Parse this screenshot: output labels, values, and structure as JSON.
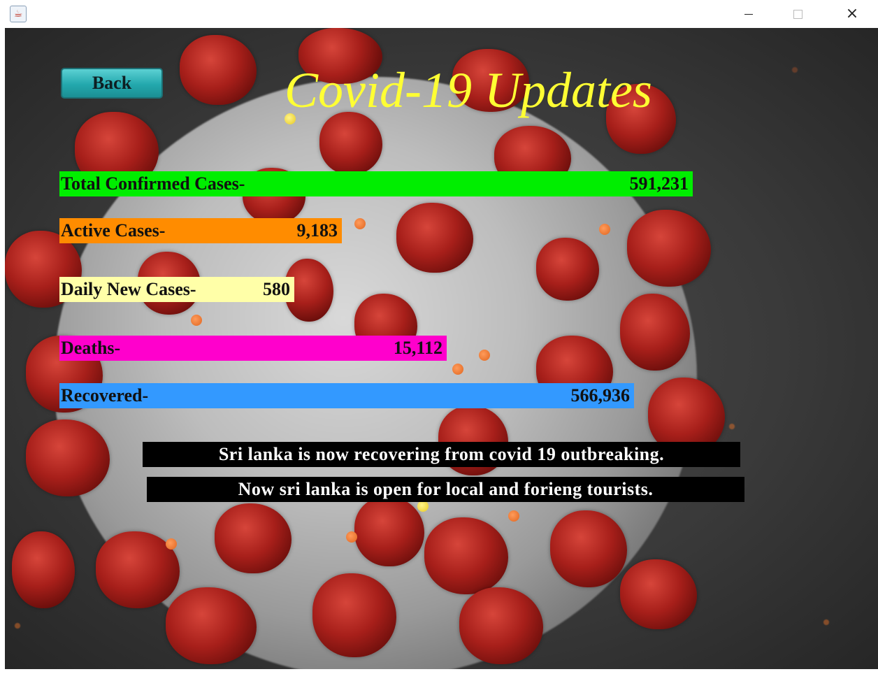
{
  "window": {
    "controls": {
      "minimize": "minimize-icon",
      "maximize": "maximize-icon",
      "close": "×"
    }
  },
  "header": {
    "back_label": "Back",
    "title": "Covid-19 Updates"
  },
  "stats": {
    "total": {
      "label": "Total Confirmed Cases-",
      "value": "591,231",
      "color": "#00ee00"
    },
    "active": {
      "label": "Active Cases-",
      "value": "9,183",
      "color": "#ff8c00"
    },
    "daily": {
      "label": "Daily New Cases-",
      "value": "580",
      "color": "#ffffa8"
    },
    "deaths": {
      "label": "Deaths-",
      "value": "15,112",
      "color": "#ff00cc"
    },
    "recovered": {
      "label": "Recovered-",
      "value": "566,936",
      "color": "#3399ff"
    }
  },
  "messages": {
    "line1": "Sri lanka is now recovering from covid 19 outbreaking.",
    "line2": "Now sri lanka is open for local and forieng tourists."
  },
  "theme": {
    "title_color": "#ffff33",
    "banner_bg": "#000000",
    "banner_text": "#ffffff"
  }
}
